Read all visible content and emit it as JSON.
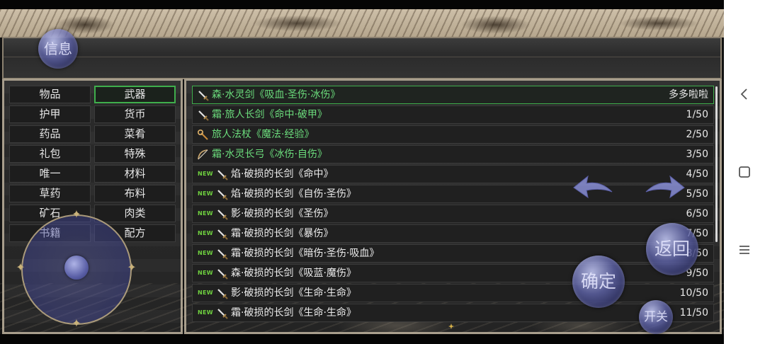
{
  "header": {
    "info_label": "信息"
  },
  "categories": [
    {
      "label": "物品",
      "active": false
    },
    {
      "label": "武器",
      "active": true
    },
    {
      "label": "护甲",
      "active": false
    },
    {
      "label": "货币",
      "active": false
    },
    {
      "label": "药品",
      "active": false
    },
    {
      "label": "菜肴",
      "active": false
    },
    {
      "label": "礼包",
      "active": false
    },
    {
      "label": "特殊",
      "active": false
    },
    {
      "label": "唯一",
      "active": false
    },
    {
      "label": "材料",
      "active": false
    },
    {
      "label": "草药",
      "active": false
    },
    {
      "label": "布料",
      "active": false
    },
    {
      "label": "矿石",
      "active": false
    },
    {
      "label": "肉类",
      "active": false
    },
    {
      "label": "书籍",
      "active": false
    },
    {
      "label": "配方",
      "active": false
    }
  ],
  "items": [
    {
      "name": "森·水灵剑《吸血·圣伤·冰伤》",
      "count": "多多啦啦",
      "icon": "sword-icon",
      "new": false,
      "green": true,
      "selected": true
    },
    {
      "name": "霜·旅人长剑《命中·破甲》",
      "count": "1/50",
      "icon": "sword-icon",
      "new": false,
      "green": true,
      "selected": false
    },
    {
      "name": "旅人法杖《魔法·经验》",
      "count": "2/50",
      "icon": "staff-icon",
      "new": false,
      "green": true,
      "selected": false
    },
    {
      "name": "霜·水灵长弓《冰伤·自伤》",
      "count": "3/50",
      "icon": "bow-icon",
      "new": false,
      "green": true,
      "selected": false
    },
    {
      "name": "焰·破损的长剑《命中》",
      "count": "4/50",
      "icon": "sword-icon",
      "new": true,
      "green": false,
      "selected": false
    },
    {
      "name": "焰·破损的长剑《自伤·圣伤》",
      "count": "5/50",
      "icon": "sword-icon",
      "new": true,
      "green": false,
      "selected": false
    },
    {
      "name": "影·破损的长剑《圣伤》",
      "count": "6/50",
      "icon": "sword-icon",
      "new": true,
      "green": false,
      "selected": false
    },
    {
      "name": "霜·破损的长剑《暴伤》",
      "count": "7/50",
      "icon": "sword-icon",
      "new": true,
      "green": false,
      "selected": false
    },
    {
      "name": "霜·破损的长剑《暗伤·圣伤·吸血》",
      "count": "8/50",
      "icon": "sword-icon",
      "new": true,
      "green": false,
      "selected": false
    },
    {
      "name": "森·破损的长剑《吸蓝·魔伤》",
      "count": "9/50",
      "icon": "sword-icon",
      "new": true,
      "green": false,
      "selected": false
    },
    {
      "name": "影·破损的长剑《生命·生命》",
      "count": "10/50",
      "icon": "sword-icon",
      "new": true,
      "green": false,
      "selected": false
    },
    {
      "name": "霜·破损的长剑《生命·生命》",
      "count": "11/50",
      "icon": "sword-icon",
      "new": true,
      "green": false,
      "selected": false
    }
  ],
  "new_badge": "NEW",
  "controls": {
    "confirm_label": "确定",
    "back_label": "返回",
    "toggle_label": "开关"
  },
  "colors": {
    "accent_green": "#3fae4c",
    "item_green": "#6bdc7c",
    "orb_blue": "#5f64aa"
  }
}
